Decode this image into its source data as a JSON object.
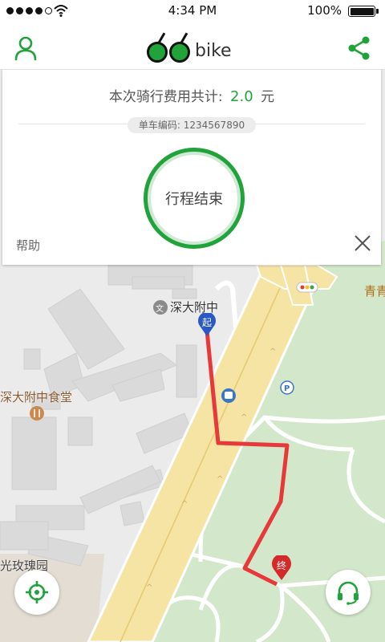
{
  "status_bar": {
    "time": "4:34 PM",
    "battery": "100%",
    "icons": [
      "signal-dots-icon",
      "wifi-icon",
      "battery-icon"
    ]
  },
  "header": {
    "logo_text": "bike",
    "icons": [
      "profile-icon",
      "share-icon"
    ],
    "brand_color": "#1fa33a"
  },
  "trip": {
    "fee_label": "本次骑行费用共计:",
    "fee_amount": "2.0",
    "fee_unit": "元",
    "bike_id": "单车编码: 1234567890",
    "end_button": "行程结束",
    "help": "帮助",
    "close_icon": "close-icon"
  },
  "map": {
    "labels": {
      "school": "深大附中",
      "canteen": "深大附中食堂",
      "garden": "光玫瑰园",
      "green_area": "青青"
    },
    "markers": {
      "start": "起",
      "end": "终"
    },
    "route_color": "#e8393a",
    "icons": [
      "school-icon",
      "restaurant-icon",
      "bus-icon",
      "parking-icon",
      "traffic-light-icon"
    ]
  },
  "floating": {
    "icons": [
      "locate-icon",
      "headset-icon"
    ]
  }
}
